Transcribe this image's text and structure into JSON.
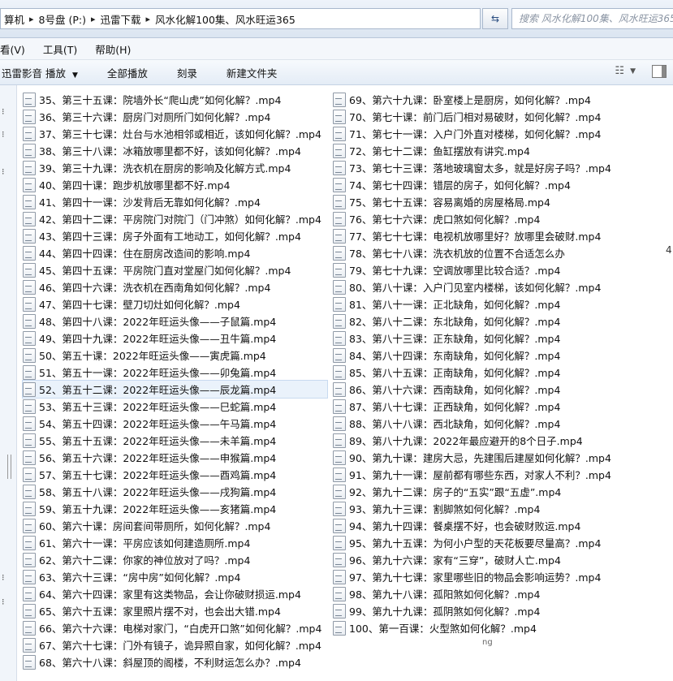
{
  "address": {
    "crumbs": [
      "算机",
      "8号盘 (P:)",
      "迅雷下载",
      "风水化解100集、风水旺运365"
    ],
    "search_placeholder": "搜索 风水化解100集、风水旺运365",
    "refresh_icon": "refresh-icon"
  },
  "menu": [
    "看(V)",
    "工具(T)",
    "帮助(H)"
  ],
  "toolbar": {
    "play": "迅雷影音 播放",
    "play_all": "全部播放",
    "burn": "刻录",
    "new_folder": "新建文件夹"
  },
  "files_left": [
    "35、第三十五课：院墙外长“爬山虎”如何化解？.mp4",
    "36、第三十六课：厨房门对厕所门如何化解？.mp4",
    "37、第三十七课：灶台与水池相邻或相近，该如何化解？.mp4",
    "38、第三十八课：冰箱放哪里都不好，该如何化解？.mp4",
    "39、第三十九课：洗衣机在厨房的影响及化解方式.mp4",
    "40、第四十课：跑步机放哪里都不好.mp4",
    "41、第四十一课：沙发背后无靠如何化解？.mp4",
    "42、第四十二课：平房院门对院门（门冲煞）如何化解？.mp4",
    "43、第四十三课：房子外面有工地动工，如何化解？.mp4",
    "44、第四十四课：住在厨房改造间的影响.mp4",
    "45、第四十五课：平房院门直对堂屋门如何化解？.mp4",
    "46、第四十六课：洗衣机在西南角如何化解？.mp4",
    "47、第四十七课：壁刀切灶如何化解？.mp4",
    "48、第四十八课：2022年旺运头像——子鼠篇.mp4",
    "49、第四十九课：2022年旺运头像——丑牛篇.mp4",
    "50、第五十课：2022年旺运头像——寅虎篇.mp4",
    "51、第五十一课：2022年旺运头像——卯兔篇.mp4",
    "52、第五十二课：2022年旺运头像——辰龙篇.mp4",
    "53、第五十三课：2022年旺运头像——巳蛇篇.mp4",
    "54、第五十四课：2022年旺运头像——午马篇.mp4",
    "55、第五十五课：2022年旺运头像——未羊篇.mp4",
    "56、第五十六课：2022年旺运头像——申猴篇.mp4",
    "57、第五十七课：2022年旺运头像——酉鸡篇.mp4",
    "58、第五十八课：2022年旺运头像——戌狗篇.mp4",
    "59、第五十九课：2022年旺运头像——亥猪篇.mp4",
    "60、第六十课：房间套间带厕所，如何化解？.mp4",
    "61、第六十一课：平房应该如何建造厕所.mp4",
    "62、第六十二课：你家的神位放对了吗？.mp4",
    "63、第六十三课：“房中房”如何化解？.mp4",
    "64、第六十四课：家里有这类物品，会让你破财损运.mp4",
    "65、第六十五课：家里照片摆不对，也会出大错.mp4",
    "66、第六十六课：电梯对家门，“白虎开口煞”如何化解？.mp4",
    "67、第六十七课：门外有镜子，诡异照自家，如何化解？.mp4",
    "68、第六十八课：斜屋顶的阁楼，不利财运怎么办？.mp4"
  ],
  "files_right": [
    "69、第六十九课：卧室楼上是厨房，如何化解？.mp4",
    "70、第七十课：前门后门相对易破财，如何化解？.mp4",
    "71、第七十一课：入户门外直对楼梯，如何化解？.mp4",
    "72、第七十二课：鱼缸摆放有讲究.mp4",
    "73、第七十三课：落地玻璃窗太多，就是好房子吗？.mp4",
    "74、第七十四课：错层的房子，如何化解？.mp4",
    "75、第七十五课：容易离婚的房屋格局.mp4",
    "76、第七十六课：虎口煞如何化解？.mp4",
    "77、第七十七课：电视机放哪里好？放哪里会破财.mp4",
    "78、第七十八课：洗衣机放的位置不合适怎么办",
    "79、第七十九课：空调放哪里比较合适？.mp4",
    "80、第八十课：入户门见室内楼梯，该如何化解？.mp4",
    "81、第八十一课：正北缺角，如何化解？.mp4",
    "82、第八十二课：东北缺角，如何化解？.mp4",
    "83、第八十三课：正东缺角，如何化解？.mp4",
    "84、第八十四课：东南缺角，如何化解？.mp4",
    "85、第八十五课：正南缺角，如何化解？.mp4",
    "86、第八十六课：西南缺角，如何化解？.mp4",
    "87、第八十七课：正西缺角，如何化解？.mp4",
    "88、第八十八课：西北缺角，如何化解？.mp4",
    "89、第八十九课：2022年最应避开的8个日子.mp4",
    "90、第九十课：建房大忌，先建围后建屋如何化解？.mp4",
    "91、第九十一课：屋前都有哪些东西，对家人不利？.mp4",
    "92、第九十二课：房子的“五实”跟“五虚”.mp4",
    "93、第九十三课：割脚煞如何化解？.mp4",
    "94、第九十四课：餐桌摆不好，也会破财败运.mp4",
    "95、第九十五课：为何小户型的天花板要尽量高？.mp4",
    "96、第九十六课：家有“三穿”，破财人亡.mp4",
    "97、第九十七课：家里哪些旧的物品会影响运势？.mp4",
    "98、第九十八课：孤阳煞如何化解？.mp4",
    "99、第九十九课：孤阴煞如何化解？.mp4",
    "100、第一百课：火型煞如何化解？.mp4"
  ],
  "selected_index_left": 17,
  "right_edge_char": "4",
  "trailing_text": "ng"
}
